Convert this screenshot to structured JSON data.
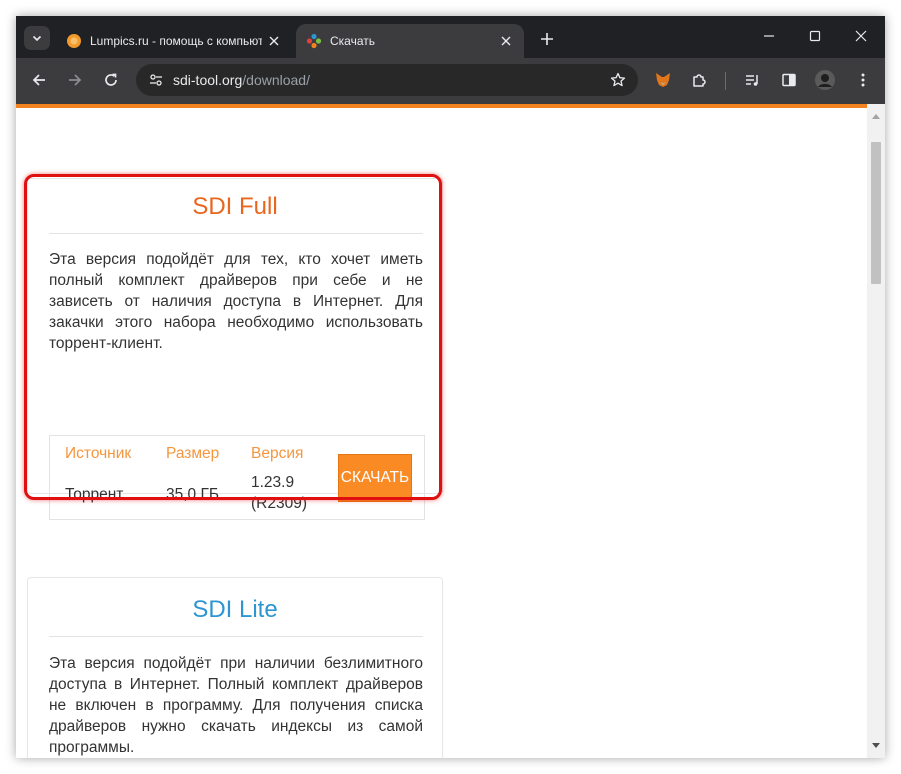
{
  "browser": {
    "tabs": [
      {
        "title": "Lumpics.ru - помощь с компьютером",
        "favicon": "orange-circle-icon",
        "active": false
      },
      {
        "title": "Скачать",
        "favicon": "sdi-logo-icon",
        "active": true
      }
    ],
    "address_bar": {
      "host": "sdi-tool.org",
      "path": "/download/"
    }
  },
  "page": {
    "accent_color": "#f4821f",
    "cards": [
      {
        "title": "SDI Full",
        "description": "Эта версия подойдёт для тех, кто хочет иметь полный комплект драйверов при себе и не зависеть от наличия доступа в Интернет. Для закачки этого набора необходимо использовать торрент-клиент.",
        "table": {
          "headers": [
            "Источник",
            "Размер",
            "Версия"
          ],
          "source": "Торрент",
          "size": "35,0 ГБ",
          "version_line1": "1.23.9",
          "version_line2": "(R2309)",
          "button": "СКАЧАТЬ"
        }
      },
      {
        "title": "SDI Lite",
        "description": "Эта версия подойдёт при наличии безлимитного доступа в Интернет. Полный комплект драйверов не включен в программу. Для получения списка драйверов нужно скачать индексы из самой программы."
      }
    ]
  }
}
